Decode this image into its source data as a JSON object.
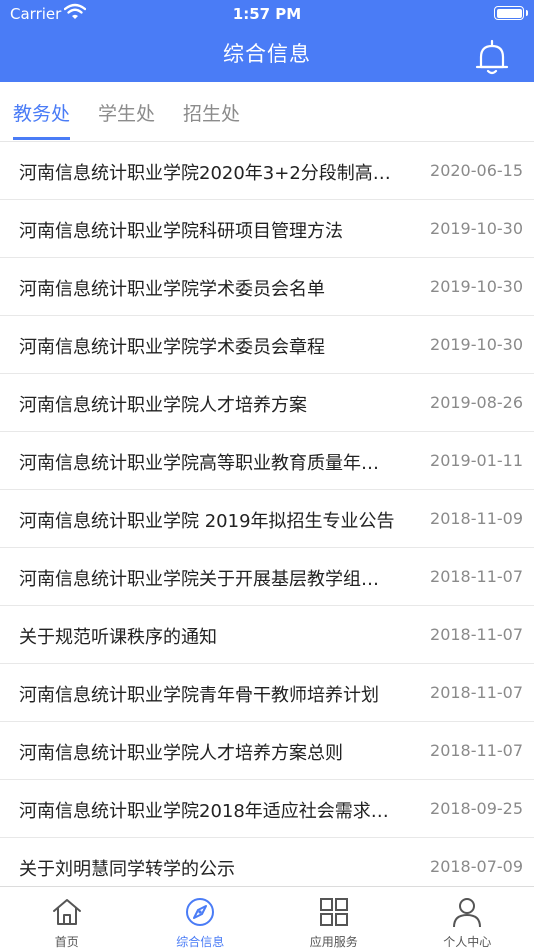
{
  "status_bar": {
    "carrier": "Carrier",
    "time": "1:57 PM"
  },
  "header": {
    "title": "综合信息"
  },
  "tabs": [
    {
      "label": "教务处",
      "active": true
    },
    {
      "label": "学生处",
      "active": false
    },
    {
      "label": "招生处",
      "active": false
    }
  ],
  "list": [
    {
      "title": "河南信息统计职业学院2020年3+2分段制高…",
      "date": "2020-06-15"
    },
    {
      "title": "河南信息统计职业学院科研项目管理方法",
      "date": "2019-10-30"
    },
    {
      "title": "河南信息统计职业学院学术委员会名单",
      "date": "2019-10-30"
    },
    {
      "title": "河南信息统计职业学院学术委员会章程",
      "date": "2019-10-30"
    },
    {
      "title": "河南信息统计职业学院人才培养方案",
      "date": "2019-08-26"
    },
    {
      "title": "河南信息统计职业学院高等职业教育质量年…",
      "date": "2019-01-11"
    },
    {
      "title": "河南信息统计职业学院 2019年拟招生专业公告",
      "date": "2018-11-09"
    },
    {
      "title": "河南信息统计职业学院关于开展基层教学组…",
      "date": "2018-11-07"
    },
    {
      "title": "关于规范听课秩序的通知",
      "date": "2018-11-07"
    },
    {
      "title": "河南信息统计职业学院青年骨干教师培养计划",
      "date": "2018-11-07"
    },
    {
      "title": "河南信息统计职业学院人才培养方案总则",
      "date": "2018-11-07"
    },
    {
      "title": "河南信息统计职业学院2018年适应社会需求…",
      "date": "2018-09-25"
    },
    {
      "title": "关于刘明慧同学转学的公示",
      "date": "2018-07-09"
    }
  ],
  "tabbar": [
    {
      "label": "首页",
      "icon": "home-icon",
      "active": false
    },
    {
      "label": "综合信息",
      "icon": "compass-icon",
      "active": true
    },
    {
      "label": "应用服务",
      "icon": "grid-icon",
      "active": false
    },
    {
      "label": "个人中心",
      "icon": "person-icon",
      "active": false
    }
  ],
  "colors": {
    "accent": "#4a7cf6",
    "text": "#222222",
    "muted": "#8a8a8a"
  }
}
